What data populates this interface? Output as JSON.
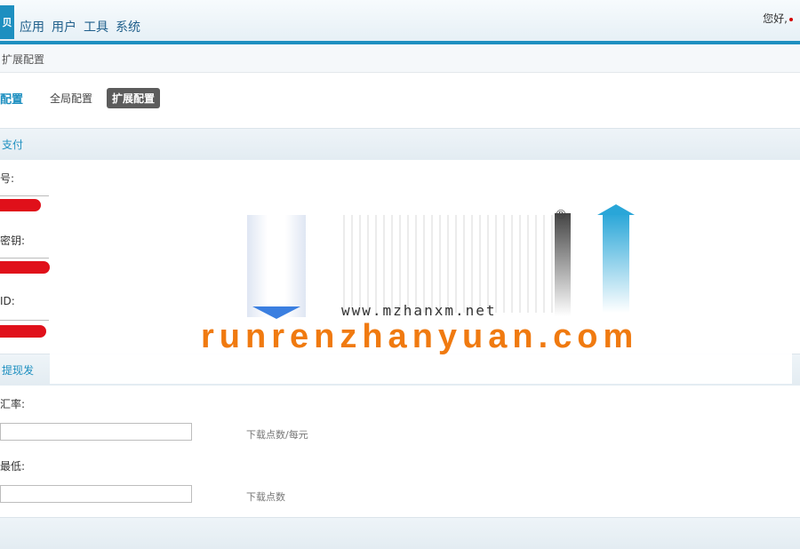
{
  "header": {
    "logo_text": "贝",
    "nav": [
      "应用",
      "用户",
      "工具",
      "系统"
    ],
    "greeting": "您好,"
  },
  "breadcrumb": "扩展配置",
  "subtabs": {
    "title": "配置",
    "items": [
      {
        "label": "全局配置",
        "active": false
      },
      {
        "label": "扩展配置",
        "active": true
      }
    ]
  },
  "sections": {
    "pay": "支付",
    "withdraw": "提现发"
  },
  "pay_fields": {
    "field1_label": "号:",
    "field2_label": "密钥:",
    "field3_label": "ID:"
  },
  "withdraw_fields": {
    "rate_label": "汇率:",
    "rate_value": "",
    "rate_hint": "下载点数/每元",
    "min_label": "最低:",
    "min_value": "",
    "min_hint": "下载点数"
  },
  "watermark": {
    "url": "www.mzhanxm.net",
    "brand": "runrenzhanyuan.com",
    "reg": "®"
  },
  "colors": {
    "accent": "#1d8fc0",
    "redact": "#e0101a",
    "brand_orange": "#f07a10"
  }
}
